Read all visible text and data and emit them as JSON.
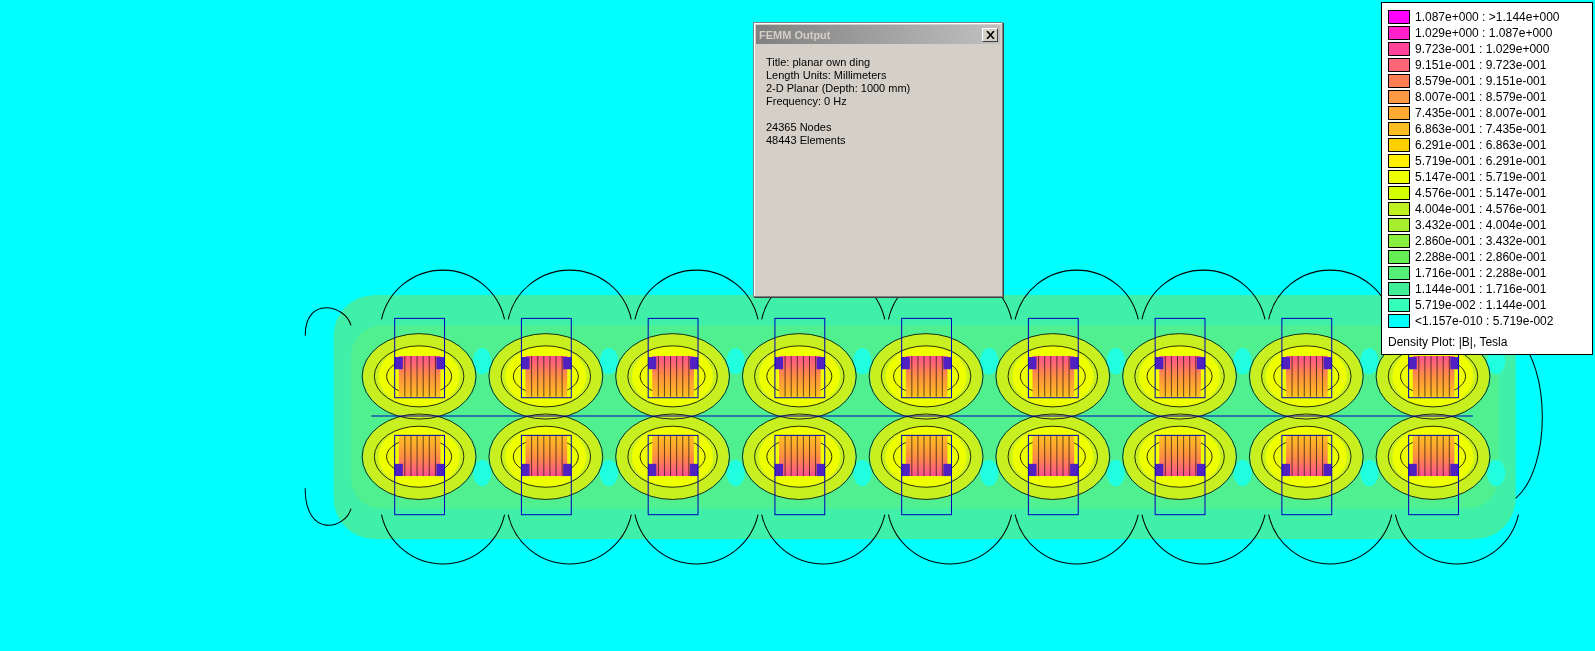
{
  "dialog": {
    "title": "FEMM Output",
    "lines": [
      "Title: planar own ding",
      "Length Units: Millimeters",
      "2-D Planar (Depth: 1000 mm)",
      "Frequency: 0 Hz"
    ],
    "stats": [
      "24365 Nodes",
      "48443 Elements"
    ]
  },
  "legend": {
    "entries": [
      {
        "range": "1.087e+000 : >1.144e+000",
        "color": "#ff00ff"
      },
      {
        "range": "1.029e+000 : 1.087e+000",
        "color": "#ff22cc"
      },
      {
        "range": "9.723e-001 : 1.029e+000",
        "color": "#ff4499"
      },
      {
        "range": "9.151e-001 : 9.723e-001",
        "color": "#ff6677"
      },
      {
        "range": "8.579e-001 : 9.151e-001",
        "color": "#ff7f55"
      },
      {
        "range": "8.007e-001 : 8.579e-001",
        "color": "#ff9944"
      },
      {
        "range": "7.435e-001 : 8.007e-001",
        "color": "#ffaa33"
      },
      {
        "range": "6.863e-001 : 7.435e-001",
        "color": "#ffbb22"
      },
      {
        "range": "6.291e-001 : 6.863e-001",
        "color": "#ffd000"
      },
      {
        "range": "5.719e-001 : 6.291e-001",
        "color": "#ffee00"
      },
      {
        "range": "5.147e-001 : 5.719e-001",
        "color": "#eeff00"
      },
      {
        "range": "4.576e-001 : 5.147e-001",
        "color": "#d4ff00"
      },
      {
        "range": "4.004e-001 : 4.576e-001",
        "color": "#c0f020"
      },
      {
        "range": "3.432e-001 : 4.004e-001",
        "color": "#a8ee30"
      },
      {
        "range": "2.860e-001 : 3.432e-001",
        "color": "#88ee40"
      },
      {
        "range": "2.288e-001 : 2.860e-001",
        "color": "#66ee55"
      },
      {
        "range": "1.716e-001 : 2.288e-001",
        "color": "#55ee77"
      },
      {
        "range": "1.144e-001 : 1.716e-001",
        "color": "#40ee99"
      },
      {
        "range": "5.719e-002 : 1.144e-001",
        "color": "#33ffbb"
      },
      {
        "range": "<1.157e-010 : 5.719e-002",
        "color": "#00ffff"
      }
    ],
    "caption": "Density Plot: |B|, Tesla"
  }
}
